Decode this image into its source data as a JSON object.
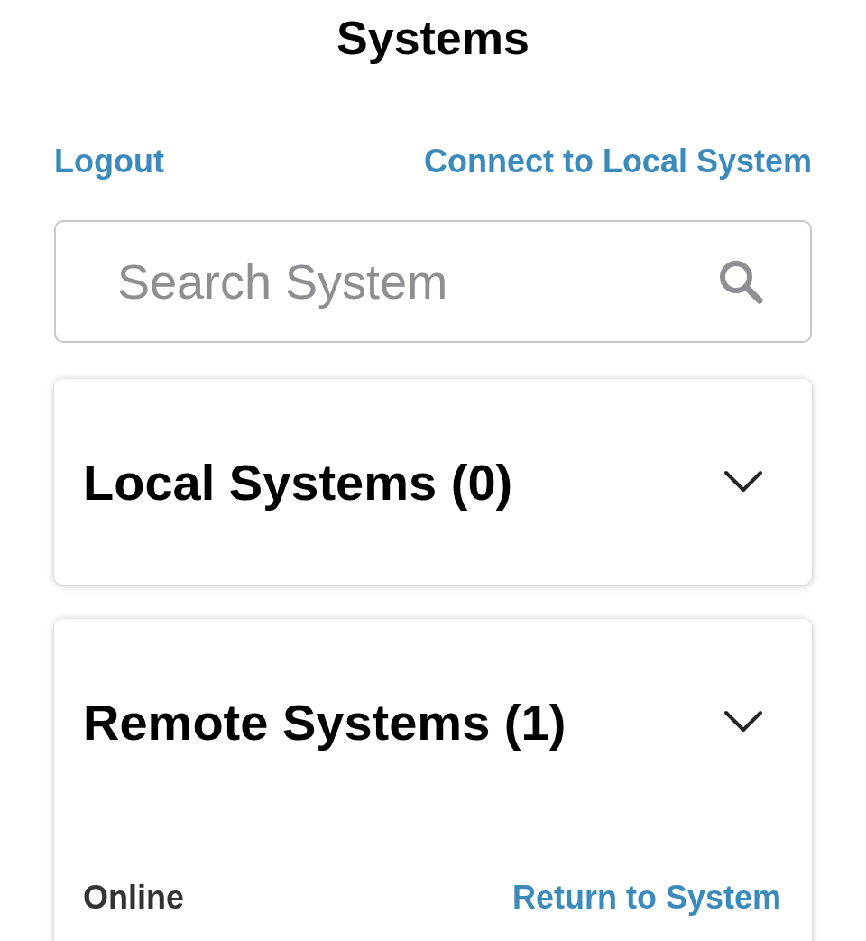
{
  "title": "Systems",
  "links": [
    {
      "label": "Logout"
    },
    {
      "label": "Connect to Local System"
    }
  ],
  "search": {
    "placeholder": "Search System"
  },
  "sections": [
    {
      "title": "Local Systems (0)"
    },
    {
      "title": "Remote Systems (1)",
      "items": [
        {
          "status": "Online",
          "action": "Return to System"
        }
      ]
    }
  ]
}
